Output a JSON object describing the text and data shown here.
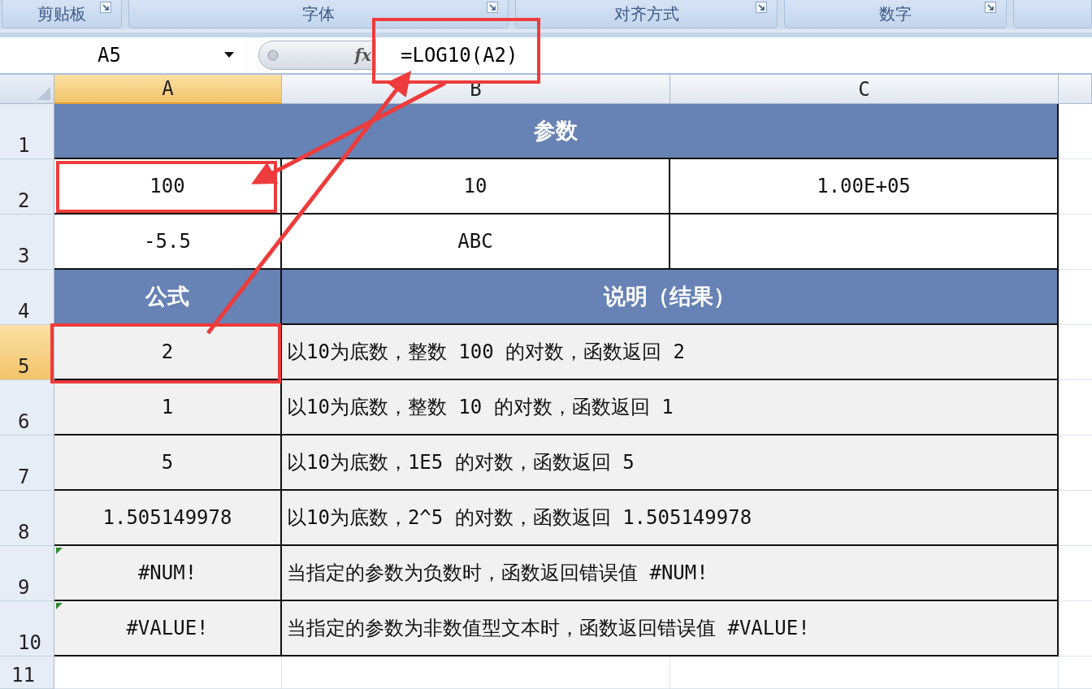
{
  "ribbon_groups": [
    {
      "label": "剪贴板"
    },
    {
      "label": "字体"
    },
    {
      "label": "对齐方式"
    },
    {
      "label": "数字"
    }
  ],
  "formula_bar": {
    "name_box": "A5",
    "fx_label": "fx",
    "formula": "=LOG10(A2)"
  },
  "columns": [
    {
      "label": "A",
      "selected": true
    },
    {
      "label": "B",
      "selected": false
    },
    {
      "label": "C",
      "selected": false
    }
  ],
  "rows": [
    {
      "number": "1",
      "selected": false,
      "cells": [
        {
          "kind": "header",
          "text": "参数"
        }
      ]
    },
    {
      "number": "2",
      "selected": false,
      "cells": [
        {
          "kind": "value",
          "text": "100"
        },
        {
          "kind": "value",
          "text": "10"
        },
        {
          "kind": "value",
          "text": "1.00E+05"
        }
      ]
    },
    {
      "number": "3",
      "selected": false,
      "cells": [
        {
          "kind": "value",
          "text": "-5.5"
        },
        {
          "kind": "value",
          "text": "ABC"
        },
        {
          "kind": "value"
        }
      ]
    },
    {
      "number": "4",
      "selected": false,
      "cells": [
        {
          "kind": "header",
          "text": "公式"
        },
        {
          "kind": "header",
          "text": "说明（结果）"
        }
      ]
    },
    {
      "number": "5",
      "selected": true,
      "cells": [
        {
          "kind": "result",
          "text": "2"
        },
        {
          "kind": "note",
          "text": "以10为底数，整数 100 的对数，函数返回 2"
        }
      ]
    },
    {
      "number": "6",
      "selected": false,
      "cells": [
        {
          "kind": "result",
          "text": "1"
        },
        {
          "kind": "note",
          "text": "以10为底数，整数 10 的对数，函数返回 1"
        }
      ]
    },
    {
      "number": "7",
      "selected": false,
      "cells": [
        {
          "kind": "result",
          "text": "5"
        },
        {
          "kind": "note",
          "text": "以10为底数，1E5 的对数，函数返回 5"
        }
      ]
    },
    {
      "number": "8",
      "selected": false,
      "cells": [
        {
          "kind": "result",
          "text": "1.505149978"
        },
        {
          "kind": "note",
          "text": "以10为底数，2^5 的对数，函数返回 1.505149978"
        }
      ]
    },
    {
      "number": "9",
      "selected": false,
      "cells": [
        {
          "kind": "result",
          "text": "#NUM!",
          "error_indicator": true
        },
        {
          "kind": "note",
          "text": "当指定的参数为负数时，函数返回错误值 #NUM!"
        }
      ]
    },
    {
      "number": "10",
      "selected": false,
      "cells": [
        {
          "kind": "result",
          "text": "#VALUE!",
          "error_indicator": true
        },
        {
          "kind": "note",
          "text": "当指定的参数为非数值型文本时，函数返回错误值 #VALUE!"
        }
      ]
    },
    {
      "number": "11",
      "selected": false
    }
  ]
}
